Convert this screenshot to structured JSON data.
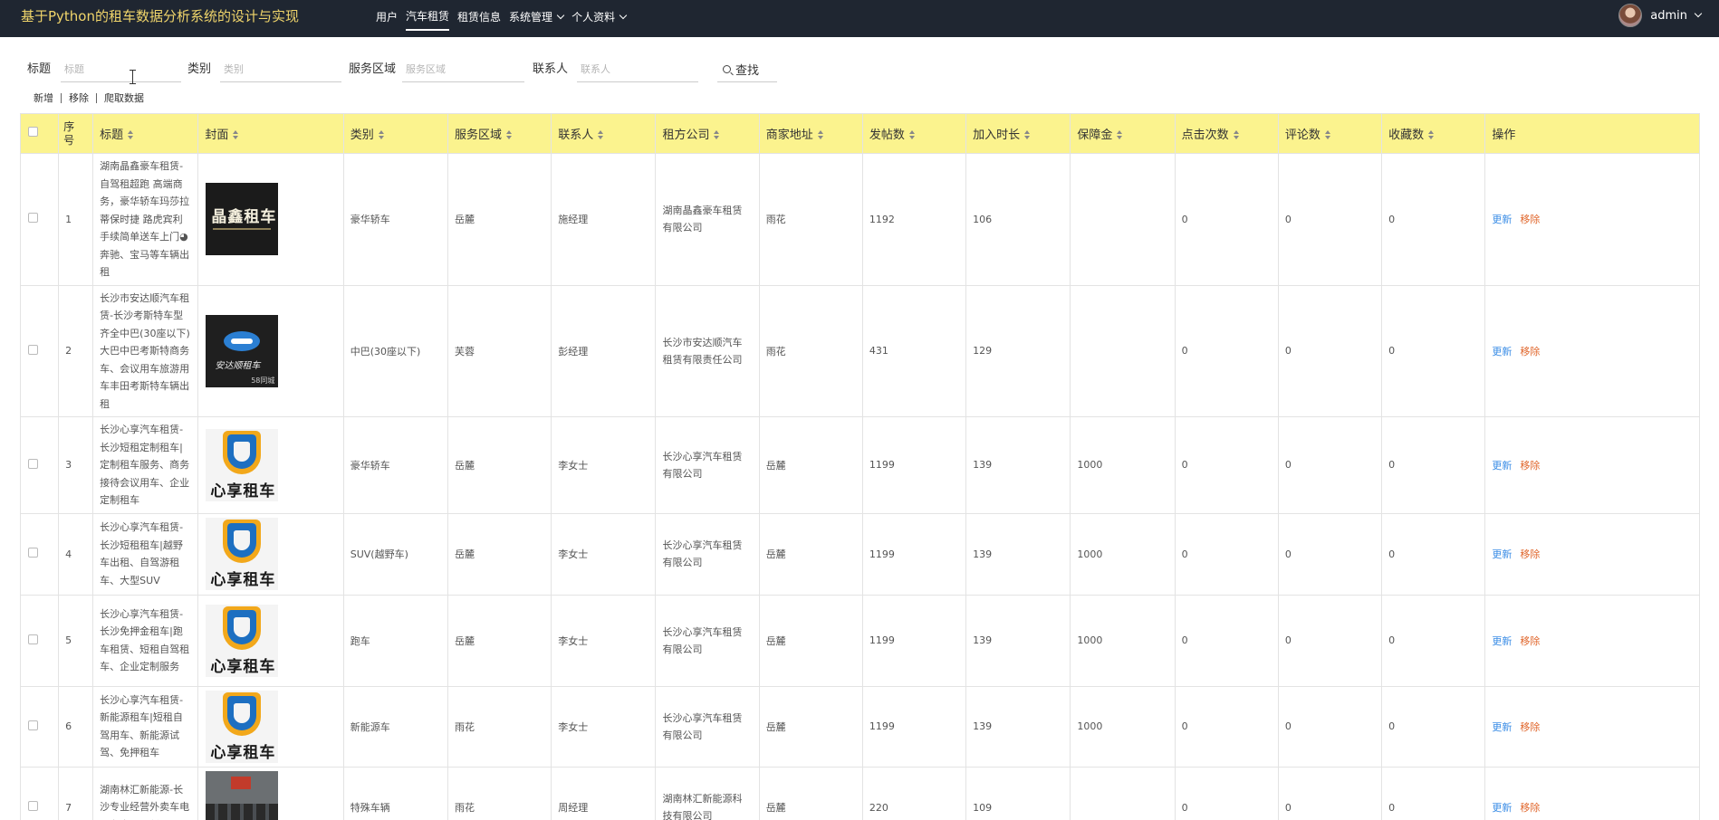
{
  "app": {
    "title": "基于Python的租车数据分析系统的设计与实现"
  },
  "nav": {
    "items": [
      {
        "label": "用户",
        "active": false,
        "dropdown": false
      },
      {
        "label": "汽车租赁",
        "active": true,
        "dropdown": false
      },
      {
        "label": "租赁信息",
        "active": false,
        "dropdown": false
      },
      {
        "label": "系统管理",
        "active": false,
        "dropdown": true
      },
      {
        "label": "个人资料",
        "active": false,
        "dropdown": true
      }
    ],
    "username": "admin"
  },
  "filters": {
    "title_label": "标题",
    "title_placeholder": "标题",
    "category_label": "类别",
    "category_placeholder": "类别",
    "area_label": "服务区域",
    "area_placeholder": "服务区域",
    "contact_label": "联系人",
    "contact_placeholder": "联系人",
    "search_label": "查找"
  },
  "actions": {
    "add": "新增",
    "remove": "移除",
    "crawl": "爬取数据"
  },
  "table": {
    "headers": {
      "index": "序号",
      "title": "标题",
      "cover": "封面",
      "category": "类别",
      "area": "服务区域",
      "contact": "联系人",
      "company": "租方公司",
      "address": "商家地址",
      "posts": "发帖数",
      "join_years": "加入时长",
      "deposit": "保障金",
      "clicks": "点击次数",
      "comments": "评论数",
      "favorites": "收藏数",
      "ops": "操作"
    },
    "op_update": "更新",
    "op_remove": "移除",
    "rows": [
      {
        "index": "1",
        "title": "湖南晶鑫豪车租赁-自驾租超跑 高端商务，豪华轿车玛莎拉蒂保时捷 路虎宾利 手续简单送车上门◕奔驰、宝马等车辆出租",
        "cover": "晶鑫租车",
        "category": "豪华轿车",
        "area": "岳麓",
        "contact": "施经理",
        "company": "湖南晶鑫豪车租赁有限公司",
        "address": "雨花",
        "posts": "1192",
        "join_years": "106",
        "deposit": "",
        "clicks": "0",
        "comments": "0",
        "favorites": "0"
      },
      {
        "index": "2",
        "title": "长沙市安达顺汽车租赁-长沙考斯特车型齐全中巴(30座以下)大巴中巴考斯特商务车、会议用车旅游用车丰田考斯特车辆出租",
        "cover": "安达顺租车",
        "category": "中巴(30座以下)",
        "area": "芙蓉",
        "contact": "彭经理",
        "company": "长沙市安达顺汽车租赁有限责任公司",
        "address": "雨花",
        "posts": "431",
        "join_years": "129",
        "deposit": "",
        "clicks": "0",
        "comments": "0",
        "favorites": "0"
      },
      {
        "index": "3",
        "title": "长沙心享汽车租赁-长沙短租定制租车|定制租车服务、商务接待会议用车、企业定制租车",
        "cover": "心享租车",
        "category": "豪华轿车",
        "area": "岳麓",
        "contact": "李女士",
        "company": "长沙心享汽车租赁有限公司",
        "address": "岳麓",
        "posts": "1199",
        "join_years": "139",
        "deposit": "1000",
        "clicks": "0",
        "comments": "0",
        "favorites": "0"
      },
      {
        "index": "4",
        "title": "长沙心享汽车租赁-长沙短租租车|越野车出租、自驾游租车、大型SUV",
        "cover": "心享租车",
        "category": "SUV(越野车)",
        "area": "岳麓",
        "contact": "李女士",
        "company": "长沙心享汽车租赁有限公司",
        "address": "岳麓",
        "posts": "1199",
        "join_years": "139",
        "deposit": "1000",
        "clicks": "0",
        "comments": "0",
        "favorites": "0"
      },
      {
        "index": "5",
        "title": "长沙心享汽车租赁-长沙免押金租车|跑车租赁、短租自驾租车、企业定制服务",
        "cover": "心享租车",
        "category": "跑车",
        "area": "岳麓",
        "contact": "李女士",
        "company": "长沙心享汽车租赁有限公司",
        "address": "岳麓",
        "posts": "1199",
        "join_years": "139",
        "deposit": "1000",
        "clicks": "0",
        "comments": "0",
        "favorites": "0"
      },
      {
        "index": "6",
        "title": "长沙心享汽车租赁-新能源租车|短租自驾用车、新能源试驾、免押租车",
        "cover": "心享租车",
        "category": "新能源车",
        "area": "雨花",
        "contact": "李女士",
        "company": "长沙心享汽车租赁有限公司",
        "address": "岳麓",
        "posts": "1199",
        "join_years": "139",
        "deposit": "1000",
        "clicks": "0",
        "comments": "0",
        "favorites": "0"
      },
      {
        "index": "7",
        "title": "湖南林汇新能源-长沙专业经营外卖车电动车出租租赁",
        "cover": "",
        "category": "特殊车辆",
        "area": "雨花",
        "contact": "周经理",
        "company": "湖南林汇新能源科技有限公司",
        "address": "岳麓",
        "posts": "220",
        "join_years": "109",
        "deposit": "",
        "clicks": "0",
        "comments": "0",
        "favorites": "0"
      }
    ]
  }
}
